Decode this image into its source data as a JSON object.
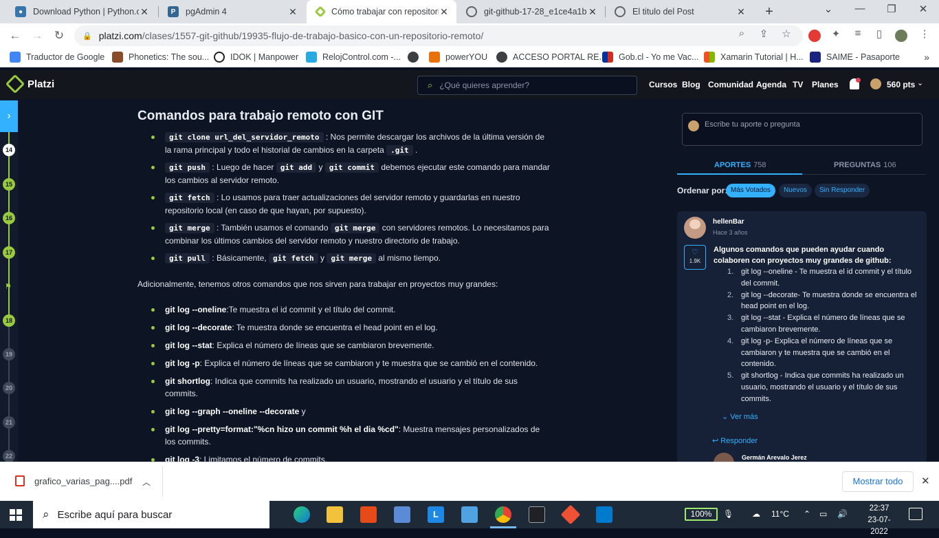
{
  "tabs": [
    {
      "title": "Download Python | Python.or",
      "active": false,
      "favicon_color": "#3776ab"
    },
    {
      "title": "pgAdmin 4",
      "active": false,
      "favicon_color": "#336791"
    },
    {
      "title": "Cómo trabajar con repositori",
      "active": true,
      "favicon_color": "#98ca3f"
    },
    {
      "title": "git-github-17-28_e1ce4a1b-",
      "active": false,
      "favicon_color": "#202124"
    },
    {
      "title": "El titulo del Post",
      "active": false,
      "favicon_color": "#5f6368"
    }
  ],
  "address": {
    "host": "platzi.com",
    "path": "/clases/1557-git-github/19935-flujo-de-trabajo-basico-con-un-repositorio-remoto/"
  },
  "bookmarks": [
    {
      "label": "Traductor de Google",
      "color": "#4285f4"
    },
    {
      "label": "Phonetics: The sou...",
      "color": "#8a4b2b"
    },
    {
      "label": "IDOK | Manpower",
      "color": "#202124"
    },
    {
      "label": "RelojControl.com -...",
      "color": "#27a9e1"
    },
    {
      "label": "",
      "color": "#3c4043"
    },
    {
      "label": "powerYOU",
      "color": "#e8710a"
    },
    {
      "label": "ACCESO PORTAL RE...",
      "color": "#3c4043"
    },
    {
      "label": "Gob.cl - Yo me Vac...",
      "color": "#d52b1e"
    },
    {
      "label": "Xamarin Tutorial | H...",
      "color": "#f4b400"
    },
    {
      "label": "SAIME - Pasaporte",
      "color": "#1a237e"
    }
  ],
  "platzi": {
    "brand": "Platzi",
    "search_placeholder": "¿Qué quieres aprender?",
    "nav": [
      "Cursos",
      "Blog",
      "Comunidad",
      "Agenda",
      "TV",
      "Planes"
    ],
    "points": "560 pts"
  },
  "rail": {
    "steps": [
      "14",
      "15",
      "16",
      "17",
      "18",
      "19",
      "20",
      "21",
      "22"
    ]
  },
  "article": {
    "heading": "Comandos para trabajo remoto con GIT",
    "remote_cmds": [
      {
        "code": "git clone url_del_servidor_remoto",
        "text1": ": Nos permite descargar los archivos de la última versión de la rama principal y todo el historial de cambios en la carpeta ",
        "code2": ".git",
        "text2": "."
      },
      {
        "code": "git push",
        "text1": ": Luego de hacer ",
        "code2": "git add",
        "text2": " y ",
        "code3": "git commit",
        "text3": " debemos ejecutar este comando para mandar los cambios al servidor remoto."
      },
      {
        "code": "git fetch",
        "text1": ": Lo usamos para traer actualizaciones del servidor remoto y guardarlas en nuestro repositorio local (en caso de que hayan, por supuesto)."
      },
      {
        "code": "git merge",
        "text1": ": También usamos el comando ",
        "code2": "git merge",
        "text2": " con servidores remotos. Lo necesitamos para combinar los últimos cambios del servidor remoto y nuestro directorio de trabajo."
      },
      {
        "code": "git pull",
        "text1": ": Básicamente, ",
        "code2": "git fetch",
        "text2": " y ",
        "code3": "git merge",
        "text3": " al mismo tiempo."
      }
    ],
    "intro": "Adicionalmente, tenemos otros comandos que nos sirven para trabajar en proyectos muy grandes:",
    "extra_cmds": [
      {
        "b": "git log --oneline",
        "t": ":Te muestra el id commit y el título del commit."
      },
      {
        "b": "git log --decorate",
        "t": ": Te muestra donde se encuentra el head point en el log."
      },
      {
        "b": "git log --stat",
        "t": ": Explica el número de líneas que se cambiaron brevemente."
      },
      {
        "b": "git log -p",
        "t": ": Explica el número de líneas que se cambiaron y te muestra que se cambió en el contenido."
      },
      {
        "b": "git shortlog",
        "t": ": Indica que commits ha realizado un usuario, mostrando el usuario y el título de sus commits."
      },
      {
        "b": "git log --graph --oneline --decorate",
        "t": " y"
      },
      {
        "b": "git log --pretty=format:\"%cn hizo un commit %h el dia %cd\"",
        "t": ": Muestra mensajes personalizados de los commits."
      },
      {
        "b": "git log -3",
        "t": ": Limitamos el número de commits."
      }
    ]
  },
  "sidebar": {
    "ask_placeholder": "Escribe tu aporte o pregunta",
    "tab_aportes": "APORTES",
    "aportes_count": "758",
    "tab_preguntas": "PREGUNTAS",
    "preguntas_count": "106",
    "order_label": "Ordenar por:",
    "chips": [
      "Más Votados",
      "Nuevos",
      "Sin Responder"
    ],
    "comment": {
      "user": "hellenBar",
      "time": "Hace 3 años",
      "likes": "1.9K",
      "intro": "Algunos comandos que pueden ayudar cuando colaboren con proyectos muy grandes de github:",
      "items": [
        "git log --oneline - Te muestra el id commit y el título del commit.",
        "git log --decorate- Te muestra donde se encuentra el head point en el log.",
        "git log --stat - Explica el número de líneas que se cambiaron brevemente.",
        "git log -p- Explica el número de líneas que se cambiaron y te muestra que se cambió en el contenido.",
        "git shortlog - Indica que commits ha realizado un usuario, mostrando el usuario y el título de sus commits."
      ],
      "ver_mas": "Ver más",
      "reply": "Responder"
    },
    "next_user": "Germán Arevalo Jerez"
  },
  "download": {
    "file": "grafico_varias_pag....pdf",
    "show_all": "Mostrar todo"
  },
  "taskbar": {
    "search": "Escribe aquí para buscar",
    "battery": "100%",
    "temp": "11°C",
    "time": "22:37",
    "date": "23-07-2022"
  }
}
